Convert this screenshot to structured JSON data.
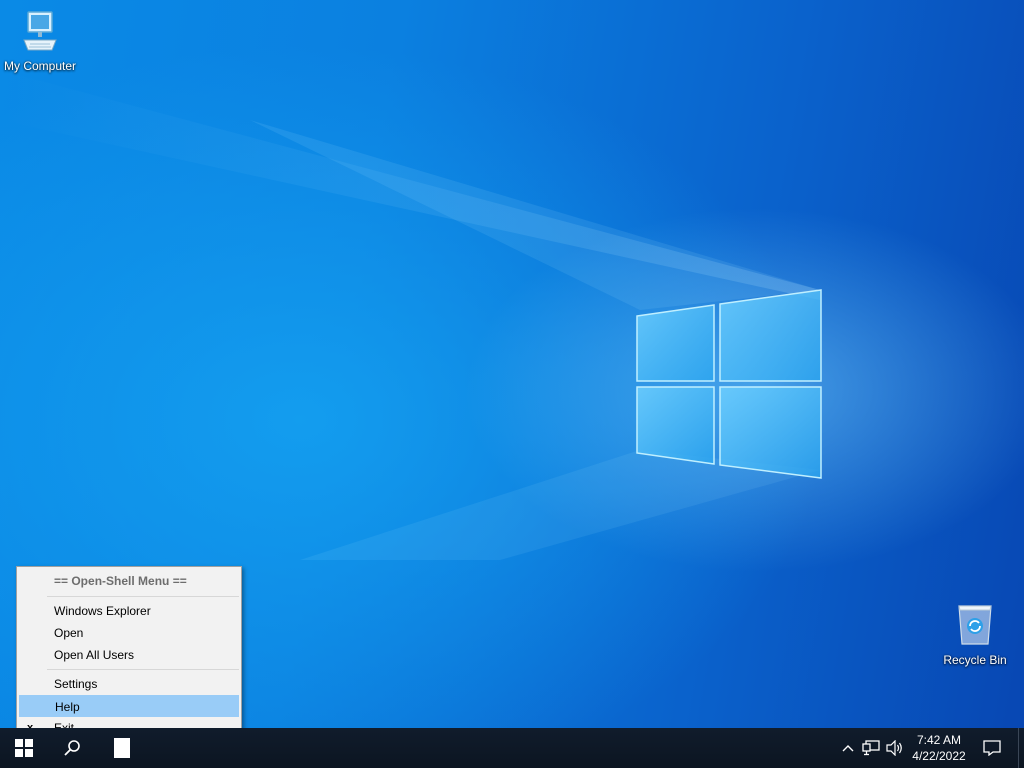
{
  "desktop": {
    "icons": [
      {
        "name": "my-computer",
        "label": "My Computer"
      },
      {
        "name": "recycle-bin",
        "label": "Recycle Bin"
      }
    ]
  },
  "context_menu": {
    "header": "== Open-Shell Menu ==",
    "items": [
      {
        "label": "Windows Explorer"
      },
      {
        "label": "Open"
      },
      {
        "label": "Open All Users"
      },
      {
        "label": "Settings"
      },
      {
        "label": "Help",
        "highlighted": true
      },
      {
        "label": "Exit",
        "check": "x"
      }
    ]
  },
  "taskbar": {
    "start_icon": "windows-start-icon",
    "search_icon": "search-icon",
    "clock": {
      "time": "7:42 AM",
      "date": "4/22/2022"
    },
    "tray_icons": [
      "chevron-up-icon",
      "network-icon",
      "volume-icon",
      "notification-icon"
    ]
  },
  "colors": {
    "taskbar": "#0f1b2a",
    "menu_bg": "#f2f2f2",
    "menu_highlight": "#99ccf7",
    "wallpaper_accent": "#0a8ae6"
  }
}
